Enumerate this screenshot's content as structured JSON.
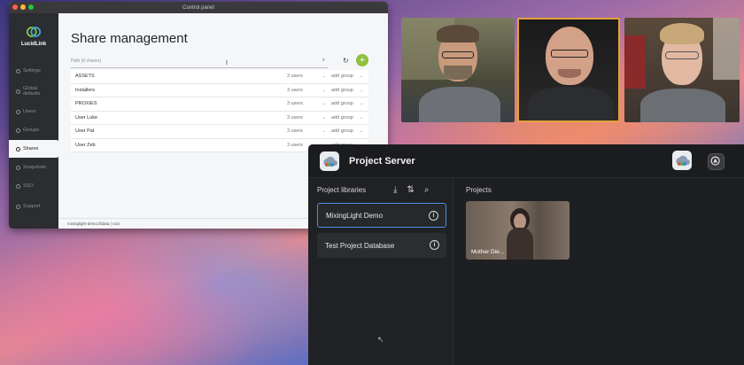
{
  "control_panel": {
    "window_title": "Control panel",
    "logo_text": "LucidLink",
    "nav": [
      {
        "label": "Settings",
        "icon": "gear-icon"
      },
      {
        "label": "Global defaults",
        "icon": "globe-icon"
      },
      {
        "label": "Users",
        "icon": "user-icon"
      },
      {
        "label": "Groups",
        "icon": "group-icon"
      },
      {
        "label": "Shares",
        "icon": "share-icon"
      },
      {
        "label": "Snapshots",
        "icon": "camera-icon"
      },
      {
        "label": "SSO",
        "icon": "key-icon"
      }
    ],
    "support_label": "Support",
    "heading": "Share management",
    "path_placeholder": "Path (6 shares)",
    "add_label": "+",
    "shares": [
      {
        "name": "ASSETS",
        "users": "3 users",
        "group": "add group"
      },
      {
        "name": "Installers",
        "users": "3 users",
        "group": "add group"
      },
      {
        "name": "PROXIES",
        "users": "3 users",
        "group": "add group"
      },
      {
        "name": "User Luke",
        "users": "3 users",
        "group": "add group"
      },
      {
        "name": "User Pat",
        "users": "3 users",
        "group": "add group"
      },
      {
        "name": "User Zeb",
        "users": "3 users",
        "group": "add group"
      }
    ],
    "footer": "mixinglight-demo.ifldata  |  root"
  },
  "project_server": {
    "title": "Project Server",
    "libraries_heading": "Project libraries",
    "projects_heading": "Projects",
    "libraries": [
      {
        "name": "MixingLight Demo",
        "selected": true
      },
      {
        "name": "Test Project Database",
        "selected": false
      }
    ],
    "projects": [
      {
        "name": "Mother Die..."
      }
    ],
    "info_glyph": "i"
  },
  "colors": {
    "accent_green": "#8fc040",
    "selection_blue": "#4c8ee6",
    "highlight_orange": "#e2a23a"
  }
}
